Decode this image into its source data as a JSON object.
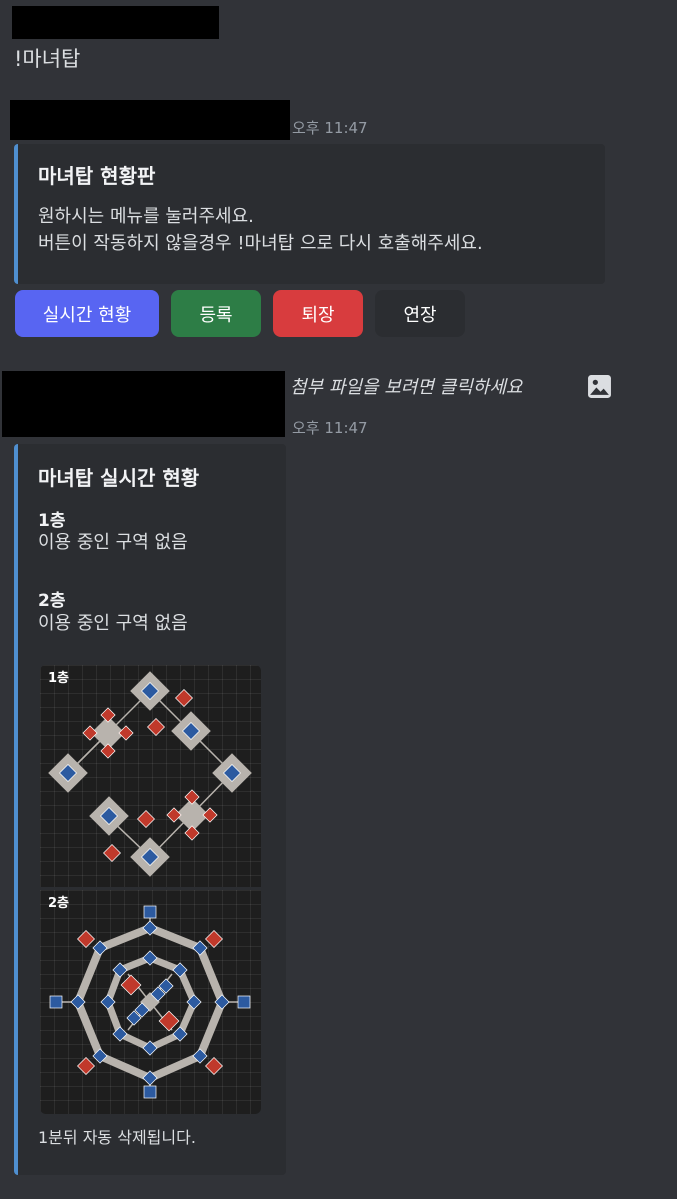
{
  "message1": {
    "content": "!마녀탑"
  },
  "message2": {
    "timestamp": "오후 11:47",
    "embed": {
      "title": "마녀탑 현황판",
      "line1": "원하시는 메뉴를 눌러주세요.",
      "line2": "버튼이 작동하지 않을경우 !마녀탑 으로 다시 호출해주세요."
    },
    "buttons": {
      "realtime": "실시간 현황",
      "register": "등록",
      "exit": "퇴장",
      "extend": "연장"
    }
  },
  "message3": {
    "reply_preview": "첨부 파일을 보려면 클릭하세요",
    "timestamp": "오후 11:47",
    "embed": {
      "title": "마녀탑 실시간 현황",
      "floor1_name": "1층",
      "floor1_status": "이용 중인 구역 없음",
      "floor2_name": "2층",
      "floor2_status": "이용 중인 구역 없음",
      "footer": "1분뒤 자동 삭제됩니다."
    },
    "image": {
      "floor1_label": "1층",
      "floor2_label": "2층"
    }
  },
  "colors": {
    "blurple": "#5865f2",
    "green": "#2d7d46",
    "red": "#d83c3e",
    "gray": "#2b2d31",
    "embed_border": "#4f8fd0",
    "node_blue": "#2c5aa0",
    "node_red": "#c0392b"
  }
}
